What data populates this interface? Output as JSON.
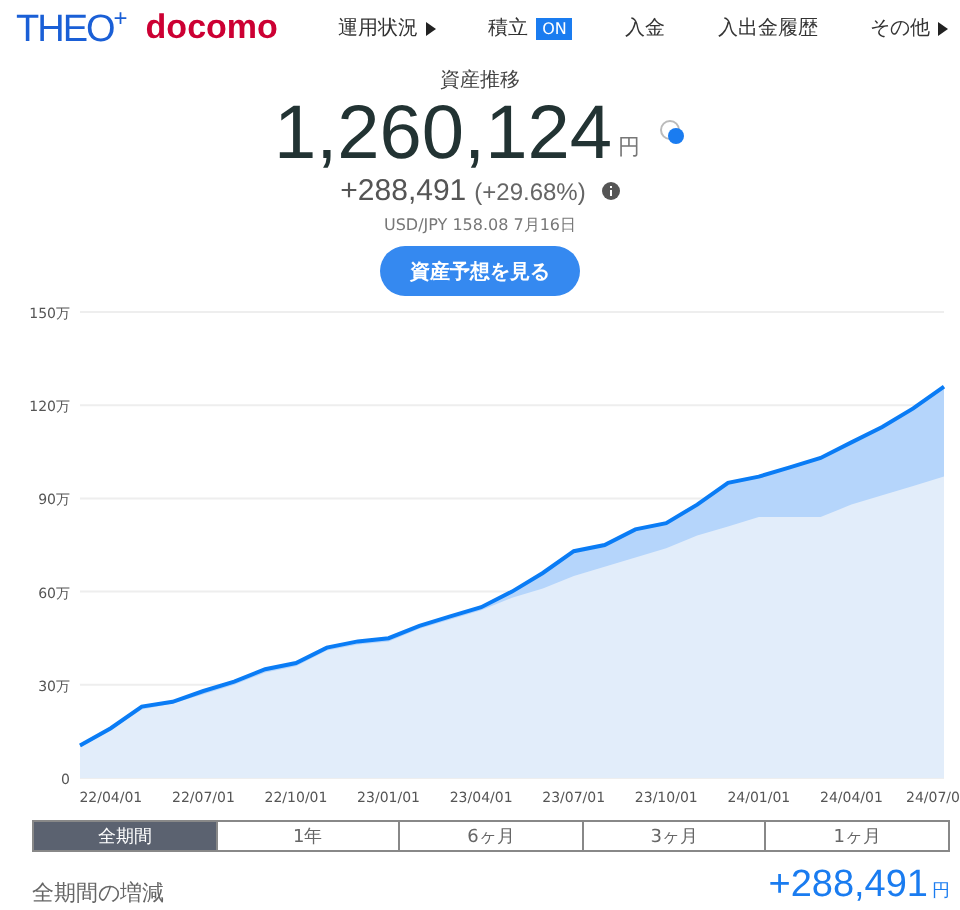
{
  "header": {
    "logo_main": "THEO$^{+}$",
    "logo_partner": "docomo",
    "nav": [
      {
        "label": "運用状況",
        "kind": "menu"
      },
      {
        "label": "積立",
        "kind": "toggle",
        "badge": "ON",
        "on": true
      },
      {
        "label": "入金",
        "kind": "link"
      },
      {
        "label": "入出金履歴",
        "kind": "link"
      },
      {
        "label": "その他",
        "kind": "menu"
      }
    ]
  },
  "summary": {
    "title": "資産推移",
    "amount": "1,260,124",
    "unit": "円",
    "change": "+288,491",
    "change_pct": "(+29.68%)",
    "fx": "USD/JPY 158.08 7月16日",
    "button": "資産予想を見る"
  },
  "chart": {
    "chart_data": {
      "type": "area",
      "categories": [
        null,
        "22/04/01",
        null,
        null,
        "22/07/01",
        null,
        null,
        "22/10/01",
        null,
        null,
        "23/01/01",
        null,
        null,
        "23/04/01",
        null,
        null,
        "23/07/01",
        null,
        null,
        "23/10/01",
        null,
        null,
        "24/01/01",
        null,
        null,
        "24/04/01",
        null,
        null,
        "24/07/0"
      ],
      "grid": true,
      "series": [
        {
          "color": "#0a7cf5",
          "values": [
            10.5,
            16,
            23,
            24.5,
            28,
            31,
            35,
            37,
            42,
            44,
            45,
            49,
            52,
            55,
            60,
            66,
            73,
            75,
            80,
            82,
            88,
            95,
            97,
            100,
            103,
            108,
            113,
            119,
            126
          ]
        },
        {
          "color": "#e2edfa",
          "values": [
            10,
            15.5,
            22,
            24,
            27,
            30,
            34,
            36,
            41,
            43,
            44,
            48,
            51,
            54,
            58,
            61,
            65,
            68,
            71,
            74,
            78,
            81,
            84,
            84,
            84,
            88,
            91,
            94,
            97
          ]
        }
      ],
      "ylim": [
        0,
        150
      ],
      "yticks": [
        {
          "value": 0,
          "label": "0"
        },
        {
          "value": 30,
          "label": "30万"
        },
        {
          "value": 60,
          "label": "60万"
        },
        {
          "value": 90,
          "label": "90万"
        },
        {
          "value": 120,
          "label": "120万"
        },
        {
          "value": 150,
          "label": "150万"
        }
      ]
    }
  },
  "periods": [
    {
      "label": "全期間",
      "selected": true
    },
    {
      "label": "1年",
      "selected": false
    },
    {
      "label": "6ヶ月",
      "selected": false
    },
    {
      "label": "3ヶ月",
      "selected": false
    },
    {
      "label": "1ヶ月",
      "selected": false
    }
  ],
  "footer": {
    "label": "全期間の増減",
    "value": "+288,491",
    "unit": "円"
  }
}
